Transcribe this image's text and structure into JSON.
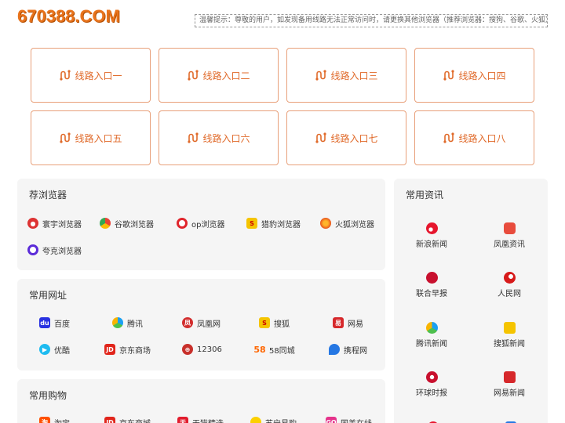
{
  "logo": "670388.COM",
  "notice": "温馨提示：尊敬的用户，如发现备用线路无法正常访问时，请更换其他浏览器（推荐浏览器：搜狗、谷歌、火狐）进行访问！",
  "routes": [
    "线路入口一",
    "线路入口二",
    "线路入口三",
    "线路入口四",
    "线路入口五",
    "线路入口六",
    "线路入口七",
    "线路入口八"
  ],
  "browsers": {
    "title": "荐浏览器",
    "items": [
      "寰宇浏览器",
      "谷歌浏览器",
      "op浏览器",
      "猎豹浏览器",
      "火狐浏览器",
      "夸克浏览器"
    ]
  },
  "sites": {
    "title": "常用网址",
    "items": [
      "百度",
      "腾讯",
      "凤凰网",
      "搜狐",
      "网易",
      "优酷",
      "京东商场",
      "12306",
      "58同城",
      "携程网"
    ]
  },
  "shopping": {
    "title": "常用购物",
    "items": [
      "淘宝",
      "京东商城",
      "天猫精选",
      "苏宁易购",
      "国美在线"
    ]
  },
  "news": {
    "title": "常用资讯",
    "items": [
      "新浪新闻",
      "凤凰资讯",
      "联合早报",
      "人民网",
      "腾讯新闻",
      "搜狐新闻",
      "环球时报",
      "网易新闻"
    ]
  },
  "colors": {
    "accent": "#e06a2a",
    "border": "#e8a07a",
    "panel": "#f5f5f5"
  }
}
